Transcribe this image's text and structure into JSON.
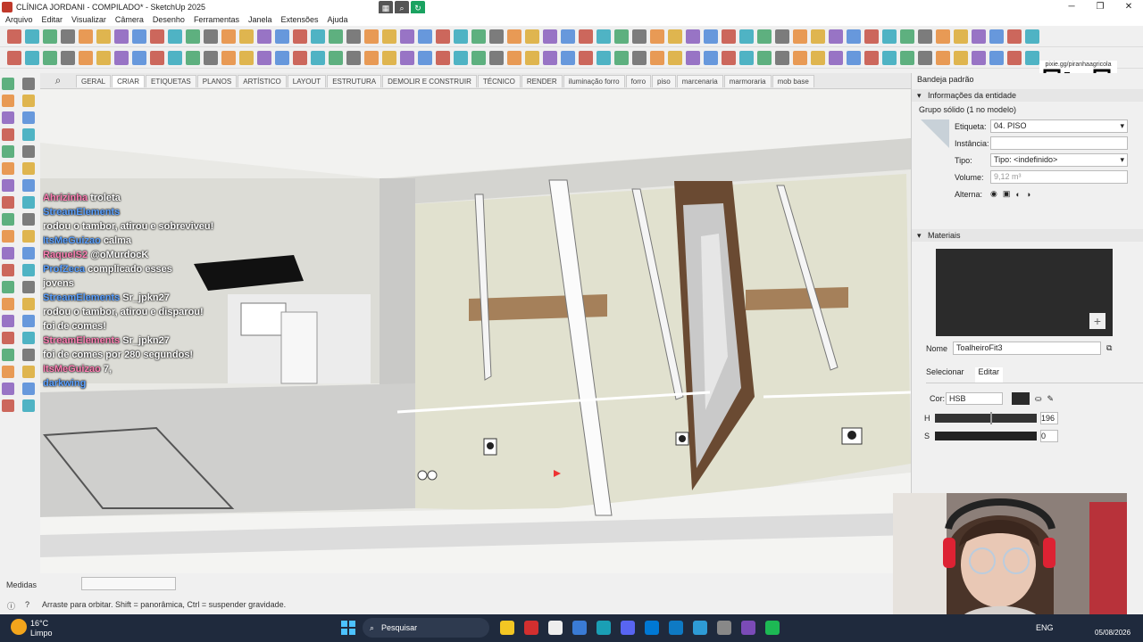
{
  "window": {
    "title": "CLÍNICA JORDANI - COMPILADO* - SketchUp 2025"
  },
  "menu": [
    "Arquivo",
    "Editar",
    "Visualizar",
    "Câmera",
    "Desenho",
    "Ferramentas",
    "Janela",
    "Extensões",
    "Ajuda"
  ],
  "scene_tabs": [
    "GERAL",
    "CRIAR",
    "ETIQUETAS",
    "PLANOS",
    "ARTÍSTICO",
    "LAYOUT",
    "ESTRUTURA",
    "DEMOLIR E CONSTRUIR",
    "TÉCNICO",
    "RENDER",
    "iluminação forro",
    "forro",
    "piso",
    "marcenaria",
    "marmoraria",
    "mob base"
  ],
  "active_tab": "CRIAR",
  "chat": [
    {
      "user": "Ahrizinha",
      "msg": "troleta"
    },
    {
      "user": "StreamElements",
      "msg": ""
    },
    {
      "user": "",
      "msg": "rodou o tambor, atirou e sobreviveu!"
    },
    {
      "user": "ItsMeGuizao",
      "msg": "calma"
    },
    {
      "user": "RaquelS2",
      "msg": "@oMurdocK"
    },
    {
      "user": "ProfZeca",
      "msg": "complicado esses"
    },
    {
      "user": "",
      "msg": "jovens"
    },
    {
      "user": "StreamElements",
      "msg": "Sr_jpkn27"
    },
    {
      "user": "",
      "msg": "rodou o tambor, atirou e disparou!"
    },
    {
      "user": "",
      "msg": "foi de comes!"
    },
    {
      "user": "StreamElements",
      "msg": "Sr_jpkn27"
    },
    {
      "user": "",
      "msg": "foi de comes por 280 segundos!"
    },
    {
      "user": "ItsMeGuizao",
      "msg": "7,"
    },
    {
      "user": "darkwing",
      "msg": ""
    }
  ],
  "panel": {
    "header": "Bandeja padrão",
    "entity_section": "Informações da entidade",
    "entity_type": "Grupo sólido (1 no modelo)",
    "etiqueta_label": "Etiqueta:",
    "etiqueta_value": "04. PISO",
    "instancia_label": "Instância:",
    "instancia_value": "",
    "tipo_label": "Tipo:",
    "tipo_value": "Tipo: <indefinido>",
    "volume_label": "Volume:",
    "volume_value": "9,12 m³",
    "alterna_label": "Alterna:",
    "materials_section": "Materiais",
    "nome_label": "Nome",
    "nome_value": "ToalheiroFit3",
    "tab_select": "Selecionar",
    "tab_edit": "Editar",
    "cor_label": "Cor:",
    "cor_mode": "HSB",
    "h_label": "H",
    "h_value": "196",
    "s_label": "S",
    "s_value": "0"
  },
  "status": {
    "medidas_label": "Medidas",
    "hint": "Arraste para orbitar. Shift = panorâmica, Ctrl = suspender gravidade."
  },
  "qr": {
    "url": "pixie.gg/piranhaagricola"
  },
  "taskbar": {
    "weather_temp": "16°C",
    "weather_desc": "Limpo",
    "search": "Pesquisar",
    "lang": "ENG",
    "date": "05/08/2026"
  }
}
